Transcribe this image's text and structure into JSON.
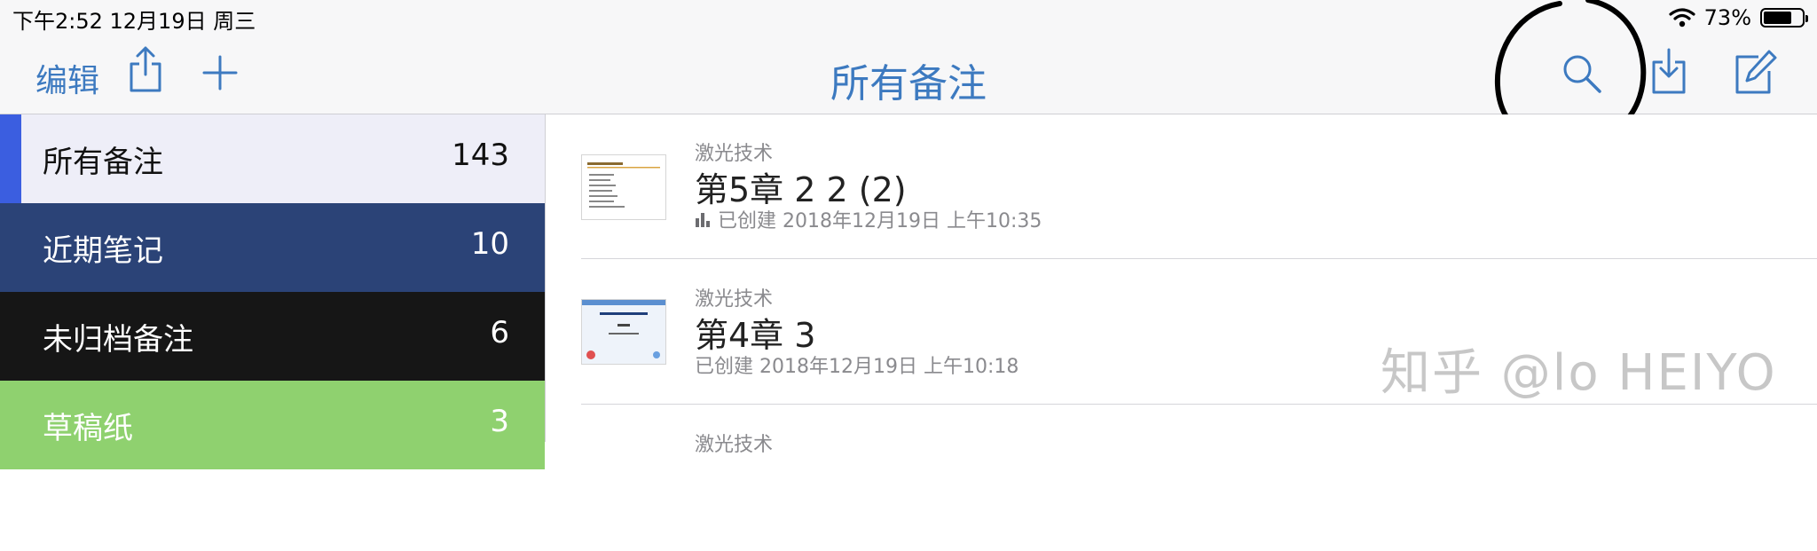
{
  "status_bar": {
    "time": "下午2:52   12月19日 周三",
    "battery_text": "73%",
    "battery_level": 0.73,
    "icons": [
      "wifi-icon",
      "battery-icon"
    ]
  },
  "nav": {
    "edit_label": "编辑",
    "title": "所有备注",
    "icons": [
      "share-icon",
      "add-icon",
      "search-icon",
      "import-icon",
      "compose-icon"
    ],
    "accent_color": "#3d7ac0"
  },
  "sidebar": {
    "items": [
      {
        "label": "所有备注",
        "count": "143",
        "bg": "#eeeef8",
        "fg": "#111111"
      },
      {
        "label": "近期笔记",
        "count": "10",
        "bg": "#2b4377",
        "fg": "#ffffff"
      },
      {
        "label": "未归档备注",
        "count": "6",
        "bg": "#161616",
        "fg": "#ffffff"
      },
      {
        "label": "草稿纸",
        "count": "3",
        "bg": "#8fd16f",
        "fg": "#ffffff"
      }
    ]
  },
  "notes": [
    {
      "notebook": "激光技术",
      "title": "第5章 2 2 (2)",
      "meta": "已创建 2018年12月19日 上午10:35",
      "has_stats_icon": true
    },
    {
      "notebook": "激光技术",
      "title": "第4章 3",
      "meta": "已创建 2018年12月19日 上午10:18",
      "has_stats_icon": false
    },
    {
      "notebook": "激光技术"
    }
  ],
  "watermark": "知乎 @lo HEIYO"
}
